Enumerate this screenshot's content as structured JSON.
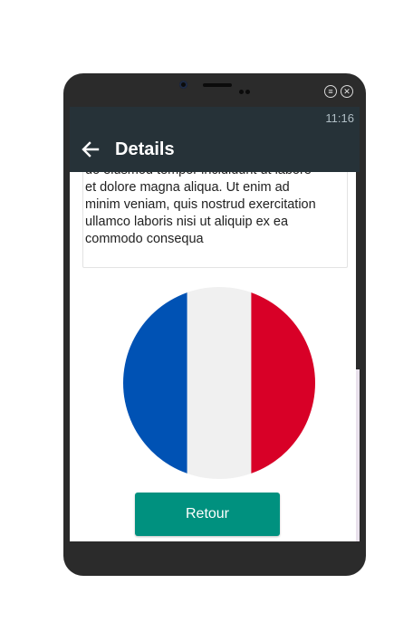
{
  "status_bar": {
    "time": "11:16"
  },
  "app_bar": {
    "title": "Details",
    "back_icon": "arrow-left-icon"
  },
  "window_controls": {
    "menu_icon": "menu-icon",
    "close_icon": "close-icon"
  },
  "content": {
    "description_lines": [
      "do eiusmod tempor incididunt ut labore",
      "et dolore magna aliqua. Ut enim ad",
      "minim veniam, quis nostrud exercitation",
      "ullamco laboris nisi ut aliquip ex ea",
      "commodo consequa"
    ],
    "flag": {
      "name": "France",
      "colors": [
        "#0052b4",
        "#f0f0f0",
        "#d80027"
      ]
    },
    "return_button_label": "Retour"
  },
  "colors": {
    "app_bar": "#263238",
    "button": "#00917f"
  }
}
